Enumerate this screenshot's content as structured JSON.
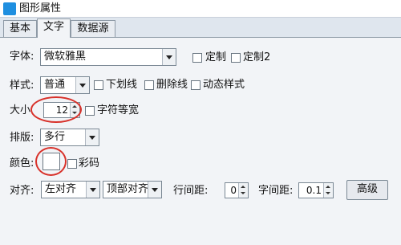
{
  "window": {
    "title": "图形属性"
  },
  "tabs": [
    {
      "label": "基本"
    },
    {
      "label": "文字"
    },
    {
      "label": "数据源"
    }
  ],
  "font": {
    "label": "字体:",
    "value": "微软雅黑",
    "custom1": "定制",
    "custom2": "定制2"
  },
  "style": {
    "label": "样式:",
    "value": "普通",
    "underline": "下划线",
    "strike": "删除线",
    "dynamic": "动态样式"
  },
  "size": {
    "label": "大小",
    "value": "12",
    "monospace": "字符等宽"
  },
  "layout": {
    "label": "排版:",
    "value": "多行"
  },
  "color": {
    "label": "颜色:",
    "color_code": "彩码",
    "swatch": "#ffffff"
  },
  "align": {
    "label": "对齐:",
    "horizontal": "左对齐",
    "vertical": "顶部对齐",
    "line_spacing_label": "行间距:",
    "line_spacing": "0",
    "char_spacing_label": "字间距:",
    "char_spacing": "0.1",
    "advanced": "高级"
  },
  "annotation_color": "#d8322b"
}
